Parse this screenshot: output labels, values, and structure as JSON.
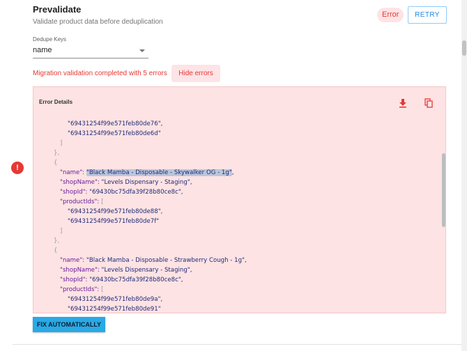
{
  "header": {
    "title": "Prevalidate",
    "subtitle": "Validate product data before deduplication",
    "status": "Error",
    "retry_label": "RETRY"
  },
  "dedupe": {
    "label": "Dedupe Keys",
    "value": "name"
  },
  "validation": {
    "message": "Migration validation completed with 5 errors",
    "hide_label": "Hide errors"
  },
  "warning_icon_glyph": "!",
  "error_panel": {
    "title": "Error Details",
    "lines": {
      "l0": "\"69431254f99e571feb80de76\",",
      "l1": "\"69431254f99e571feb80de6d\"",
      "l2": "]",
      "l3": "},",
      "l4": "{",
      "l5_key": "\"name\":",
      "l5_val": "\"Black Mamba - Disposable - Skywalker OG - 1g\"",
      "l5_end": ",",
      "l6_key": "\"shopName\":",
      "l6_val": "\"Levels Dispensary - Staging\",",
      "l7_key": "\"shopId\":",
      "l7_val": "\"69430bc75dfa39f28b80ce8c\",",
      "l8_key": "\"productIds\":",
      "l8_val": "[",
      "l9": "\"69431254f99e571feb80de88\",",
      "l10": "\"69431254f99e571feb80de7f\"",
      "l11": "]",
      "l12": "},",
      "l13": "{",
      "l14_key": "\"name\":",
      "l14_val": "\"Black Mamba - Disposable - Strawberry Cough - 1g\",",
      "l15_key": "\"shopName\":",
      "l15_val": "\"Levels Dispensary - Staging\",",
      "l16_key": "\"shopId\":",
      "l16_val": "\"69430bc75dfa39f28b80ce8c\",",
      "l17_key": "\"productIds\":",
      "l17_val": "[",
      "l18": "\"69431254f99e571feb80de9a\",",
      "l19": "\"69431254f99e571feb80de91\""
    }
  },
  "fix_label": "FIX AUTOMATICALLY",
  "colors": {
    "error": "#e53935",
    "error_bg": "#fde3e3",
    "accent": "#1e88e5",
    "fix_button": "#29a9e6"
  }
}
